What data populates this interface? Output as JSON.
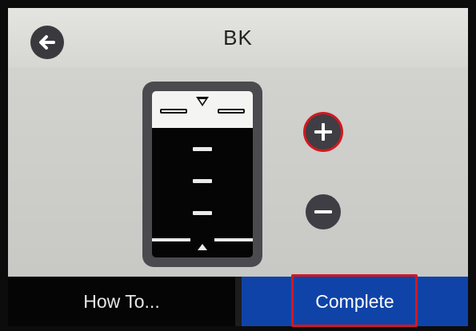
{
  "header": {
    "title": "BK",
    "back_icon": "arrow-left-icon"
  },
  "gauge": {
    "level_fraction": 0.8,
    "ink_color": "#050505",
    "tick_count": 3,
    "upper_marker_icon": "triangle-down-icon",
    "lower_marker_icon": "triangle-up-icon"
  },
  "controls": {
    "increase_icon": "plus-icon",
    "decrease_icon": "minus-icon"
  },
  "footer": {
    "howto_label": "How To...",
    "complete_label": "Complete"
  },
  "colors": {
    "highlight": "#d3181f",
    "complete_bg": "#0f43a8",
    "header_bg": "#dcdcd8"
  }
}
